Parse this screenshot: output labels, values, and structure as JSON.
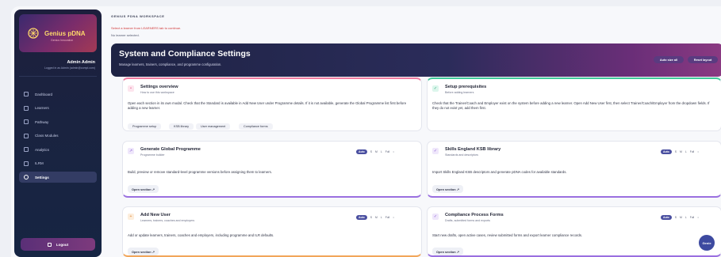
{
  "sidebar": {
    "brand": "Genius pDNA",
    "brand_sub": "Genius Innovation",
    "user_name": "Admin Admin",
    "user_email": "Logged in as Admin (admin@compl.com)",
    "items": [
      {
        "label": "Dashboard",
        "active": false
      },
      {
        "label": "Learners",
        "active": false
      },
      {
        "label": "Pathway",
        "active": false
      },
      {
        "label": "Class Modules",
        "active": false
      },
      {
        "label": "Analytics",
        "active": false
      },
      {
        "label": "ILRM",
        "active": false
      },
      {
        "label": "Settings",
        "active": true
      }
    ],
    "logout": "Logout"
  },
  "main": {
    "workspace_label": "GENIUS PDNA WORKSPACE",
    "warning": "Select a learner from LEARNERS tab to continue.",
    "no_learner": "No learner selected.",
    "banner": {
      "title": "System and Compliance Settings",
      "subtitle": "Manage learners, trainers, compliance, and programme configuration.",
      "auto_size_btn": "Auto size all",
      "reset_btn": "Reset layout"
    },
    "cards": {
      "overview": {
        "title": "Settings overview",
        "sub": "How to use this workspace",
        "desc": "Open each section in its own modal. Check that the Standard is available in Add New User under Programme details. If it is not available, generate the Global Programme list first before adding a new learner.",
        "pills": [
          "Programme setup",
          "KSB library",
          "User management",
          "Compliance forms"
        ]
      },
      "prereq": {
        "title": "Setup prerequisites",
        "sub": "Before adding learners",
        "desc": "Check that the Trainer/Coach and Employer exist on the system before adding a new learner. Open Add New User first, then select Trainer/Coach/Employer from the dropdown fields. If they do not exist yet, add them first."
      },
      "global": {
        "title": "Generate Global Programme",
        "sub": "Programme builder",
        "desc": "Build, preview or remove standard-level programme versions before assigning them to learners.",
        "open": "Open section ↗"
      },
      "ksb": {
        "title": "Skills England KSB library",
        "sub": "Standards and descriptors",
        "desc": "Import Skills England KSB descriptors and generate pDNA codes for available standards.",
        "open": "Open section ↗"
      },
      "adduser": {
        "title": "Add New User",
        "sub": "Learners, trainers, coaches and employers",
        "desc": "Add or update learners, trainers, coaches and employers, including programme and ILR defaults.",
        "open": "Open section ↗"
      },
      "compliance": {
        "title": "Compliance Process Forms",
        "sub": "Drafts, submitted forms and exports",
        "desc": "Start new drafts, open active cases, review submitted forms and export learner compliance records.",
        "open": "Open section ↗"
      }
    },
    "sizes": [
      "Auto",
      "S",
      "M",
      "L",
      "Full"
    ],
    "fab": "Genie"
  },
  "colors": {
    "pink": "#f07ba0",
    "green": "#3fc99a",
    "purple": "#9a6fe0",
    "orange": "#f2a65a",
    "brand_gold": "#ffd96a"
  }
}
